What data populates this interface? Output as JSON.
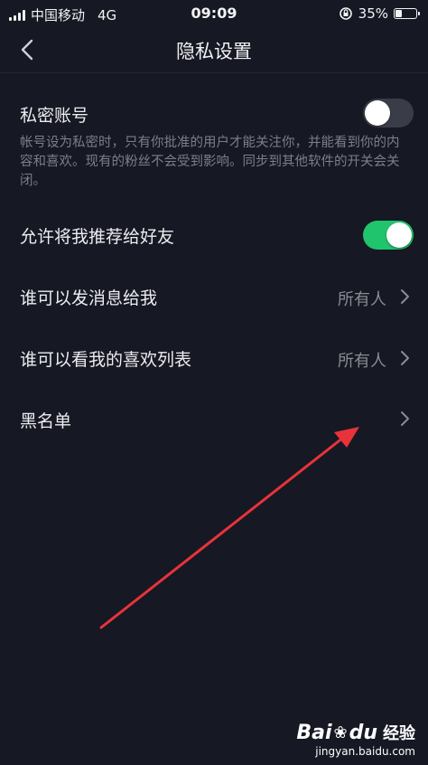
{
  "status_bar": {
    "carrier": "中国移动",
    "network": "4G",
    "time": "09:09",
    "battery_text": "35%",
    "battery_level": 0.35
  },
  "nav": {
    "title": "隐私设置"
  },
  "settings": {
    "private_account": {
      "label": "私密账号",
      "enabled": false,
      "description": "帐号设为私密时，只有你批准的用户才能关注你，并能看到你的内容和喜欢。现有的粉丝不会受到影响。同步到其他软件的开关会关闭。"
    },
    "recommend_to_friends": {
      "label": "允许将我推荐给好友",
      "enabled": true
    },
    "who_can_message": {
      "label": "谁可以发消息给我",
      "value": "所有人"
    },
    "who_can_see_likes": {
      "label": "谁可以看我的喜欢列表",
      "value": "所有人"
    },
    "blacklist": {
      "label": "黑名单"
    }
  },
  "colors": {
    "background": "#161823",
    "toggle_on": "#20c46c",
    "toggle_off": "#3a3c47",
    "annotation_arrow": "#e8333a"
  },
  "watermark": {
    "logo": "Bai du 经验",
    "url": "jingyan.baidu.com"
  }
}
